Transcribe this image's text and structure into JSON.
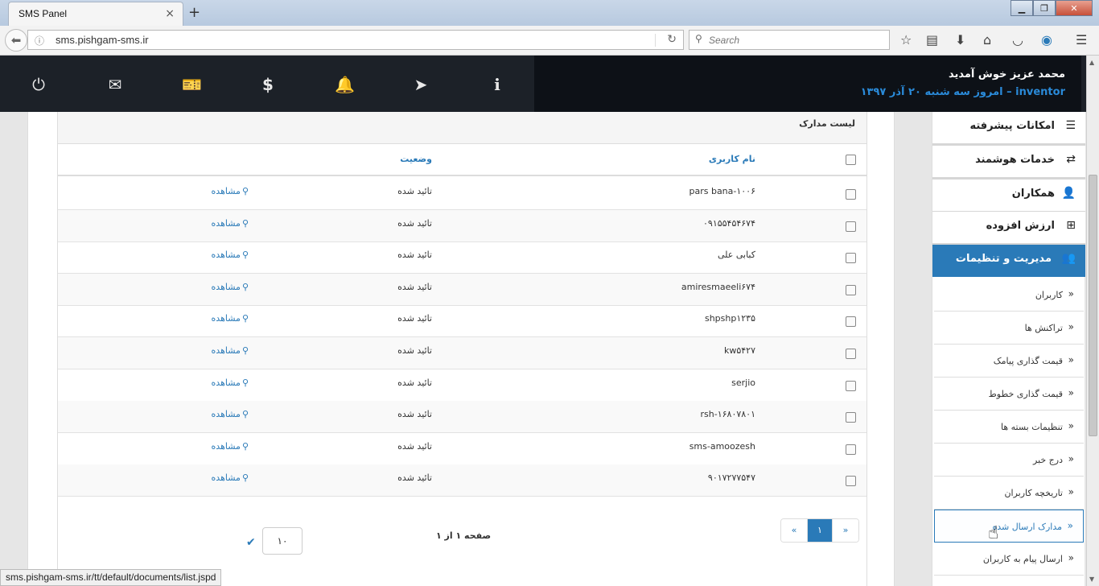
{
  "browser": {
    "tab_title": "SMS Panel",
    "tab_close": "×",
    "new_tab": "+",
    "url": "sms.pishgam-sms.ir",
    "search_placeholder": "Search",
    "status_url": "sms.pishgam-sms.ir/tt/default/documents/list.jspd",
    "window_buttons": [
      "▁",
      "❐",
      "✕"
    ],
    "toolbar_icons": [
      "bookmark-star-icon",
      "reading-list-icon",
      "download-icon",
      "home-icon",
      "pocket-icon",
      "account-icon",
      "menu-icon"
    ]
  },
  "header": {
    "welcome": "محمد عزیز خوش آمدید",
    "user": "inventor",
    "dash": " – ",
    "date": "امروز سه شنبه ۲۰ آذر ۱۳۹۷",
    "icons": [
      "power-icon",
      "mail-icon",
      "ticket-icon",
      "dollar-icon",
      "bell-icon",
      "send-icon",
      "info-icon"
    ],
    "accent": "#2a8ad8"
  },
  "panel": {
    "title": "لیست مدارک",
    "columns": {
      "username": "نام کاربری",
      "status": "وضعیت"
    },
    "rows": [
      {
        "username": "pars bana-۱۰۰۶",
        "status": "تائید شده",
        "action": "مشاهده"
      },
      {
        "username": "۰۹۱۵۵۴۵۴۶۷۴",
        "status": "تائید شده",
        "action": "مشاهده"
      },
      {
        "username": "کبابی علی",
        "status": "تائید شده",
        "action": "مشاهده"
      },
      {
        "username": "amiresmaeeli۶۷۴",
        "status": "تائید شده",
        "action": "مشاهده"
      },
      {
        "username": "shpshp۱۲۳۵",
        "status": "تائید شده",
        "action": "مشاهده"
      },
      {
        "username": "kw۵۴۲۷",
        "status": "تائید شده",
        "action": "مشاهده"
      },
      {
        "username": "serjio",
        "status": "تائید شده",
        "action": "مشاهده"
      },
      {
        "username": "rsh-۱۶۸۰۷۸۰۱",
        "status": "تائید شده",
        "action": "مشاهده"
      },
      {
        "username": "sms-amoozesh",
        "status": "تائید شده",
        "action": "مشاهده"
      },
      {
        "username": "۹۰۱۷۲۷۷۵۴۷",
        "status": "تائید شده",
        "action": "مشاهده"
      }
    ],
    "pagination": {
      "prev": "«",
      "current": "۱",
      "next": "»",
      "info": "صفحه ۱ از ۱",
      "page_size": "۱۰"
    },
    "link_color": "#2a7ab8"
  },
  "sidebar": {
    "sections": [
      {
        "label": "امکانات پیشرفته",
        "icon": "list-icon"
      },
      {
        "label": "خدمات هوشمند",
        "icon": "retweet-icon"
      },
      {
        "label": "همکاران",
        "icon": "users-icon"
      },
      {
        "label": "ارزش افزوده",
        "icon": "plus-square-icon"
      }
    ],
    "active_section": {
      "label": "مدیریت و تنظیمات",
      "icon": "group-icon"
    },
    "sub_items": [
      "کاربران",
      "تراکنش ها",
      "قیمت گذاری پیامک",
      "قیمت گذاری خطوط",
      "تنظیمات بسته ها",
      "درج خبر",
      "تاریخچه کاربران",
      "مدارک ارسال شده",
      "ارسال پیام به کاربران"
    ],
    "current_sub_item": "مدارک ارسال شده"
  }
}
